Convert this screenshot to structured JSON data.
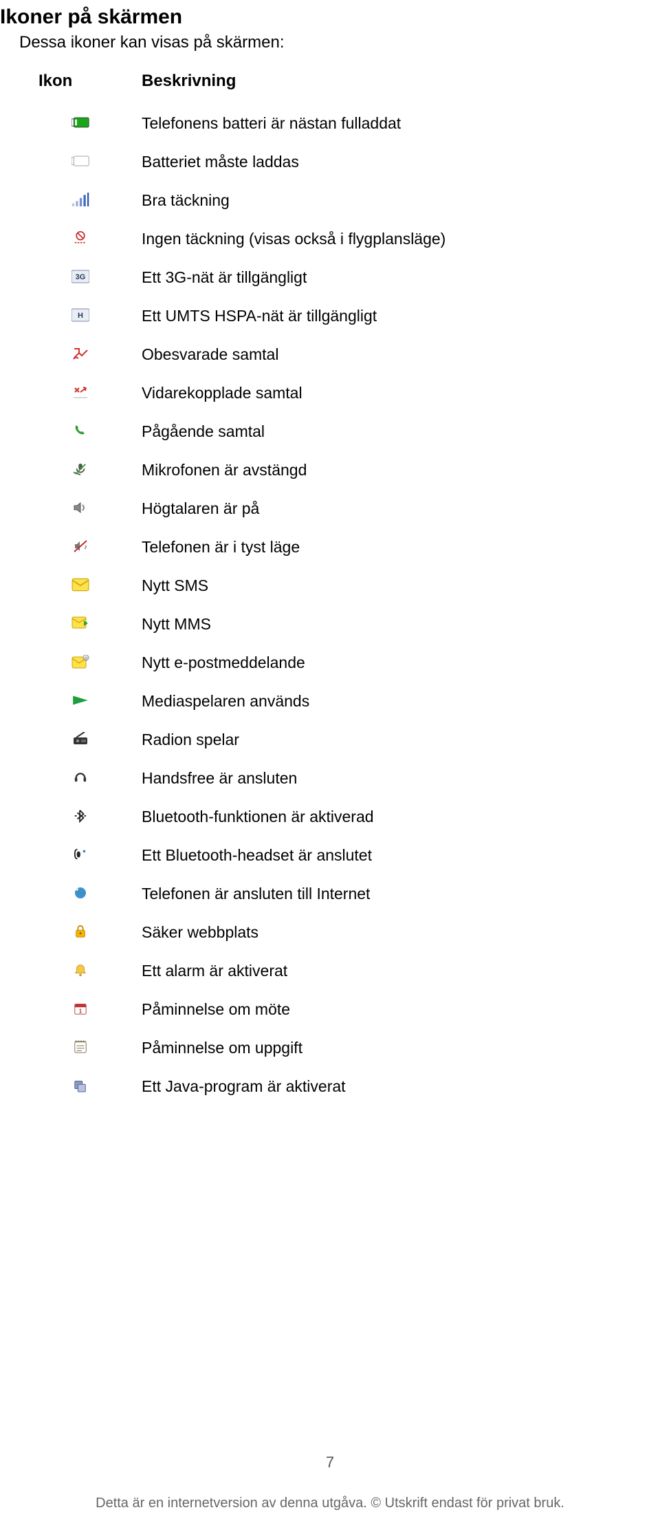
{
  "title": "Ikoner på skärmen",
  "intro": "Dessa ikoner kan visas på skärmen:",
  "columns": {
    "icon": "Ikon",
    "desc": "Beskrivning"
  },
  "rows": [
    {
      "icon": "battery-full-icon",
      "desc": "Telefonens batteri är nästan fulladdat"
    },
    {
      "icon": "battery-empty-icon",
      "desc": "Batteriet måste laddas"
    },
    {
      "icon": "signal-bars-icon",
      "desc": "Bra täckning"
    },
    {
      "icon": "no-network-icon",
      "desc": "Ingen täckning (visas också i flygplansläge)"
    },
    {
      "icon": "badge-3g-icon",
      "desc": "Ett 3G-nät är tillgängligt"
    },
    {
      "icon": "badge-h-icon",
      "desc": "Ett UMTS HSPA-nät är tillgängligt"
    },
    {
      "icon": "missed-call-icon",
      "desc": "Obesvarade samtal"
    },
    {
      "icon": "forwarded-call-icon",
      "desc": "Vidarekopplade samtal"
    },
    {
      "icon": "ongoing-call-icon",
      "desc": "Pågående samtal"
    },
    {
      "icon": "mic-muted-icon",
      "desc": "Mikrofonen är avstängd"
    },
    {
      "icon": "speaker-icon",
      "desc": "Högtalaren är på"
    },
    {
      "icon": "silent-mode-icon",
      "desc": "Telefonen är i tyst läge"
    },
    {
      "icon": "sms-icon",
      "desc": "Nytt SMS"
    },
    {
      "icon": "mms-icon",
      "desc": "Nytt MMS"
    },
    {
      "icon": "email-icon",
      "desc": "Nytt e-postmeddelande"
    },
    {
      "icon": "media-player-icon",
      "desc": "Mediaspelaren används"
    },
    {
      "icon": "radio-icon",
      "desc": "Radion spelar"
    },
    {
      "icon": "headset-icon",
      "desc": "Handsfree är ansluten"
    },
    {
      "icon": "bluetooth-on-icon",
      "desc": "Bluetooth-funktionen är aktiverad"
    },
    {
      "icon": "bluetooth-headset-icon",
      "desc": "Ett Bluetooth-headset är anslutet"
    },
    {
      "icon": "internet-icon",
      "desc": "Telefonen är ansluten till Internet"
    },
    {
      "icon": "secure-site-icon",
      "desc": "Säker webbplats"
    },
    {
      "icon": "alarm-icon",
      "desc": "Ett alarm är aktiverat"
    },
    {
      "icon": "calendar-alert-icon",
      "desc": "Påminnelse om möte"
    },
    {
      "icon": "task-alert-icon",
      "desc": "Påminnelse om uppgift"
    },
    {
      "icon": "java-app-icon",
      "desc": "Ett Java-program är aktiverat"
    }
  ],
  "page_number": "7",
  "footer": "Detta är en internetversion av denna utgåva. © Utskrift endast för privat bruk."
}
